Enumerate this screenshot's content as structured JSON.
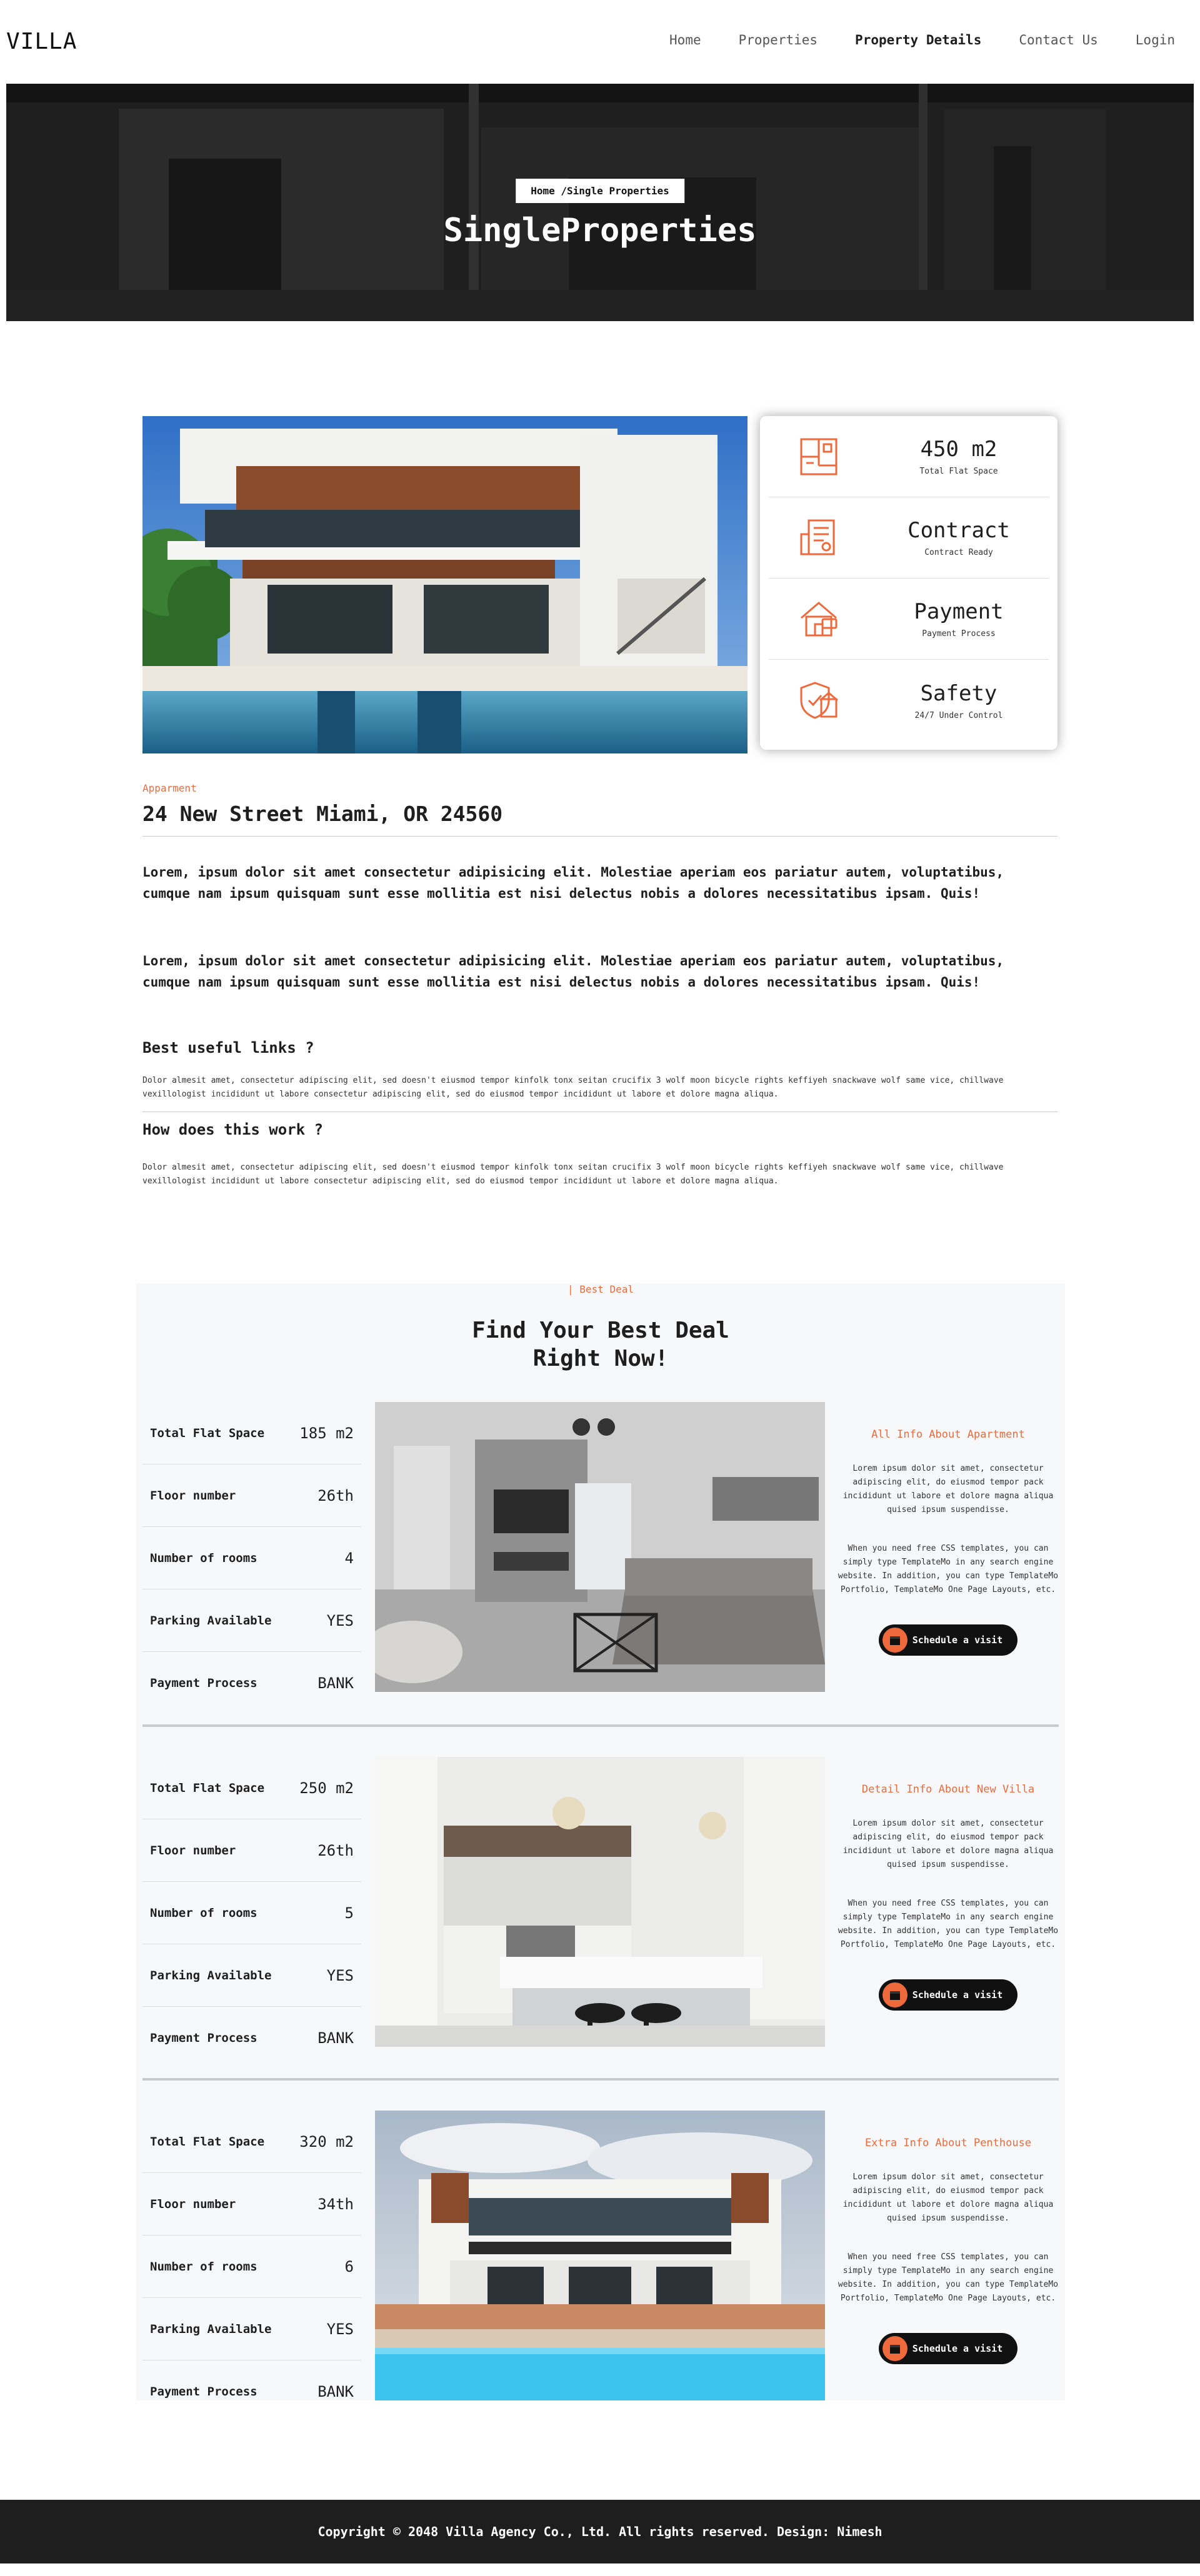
{
  "nav": {
    "logo": "VILLA",
    "items": [
      "Home",
      "Properties",
      "Property Details",
      "Contact Us",
      "Login"
    ],
    "active_index": 2
  },
  "hero": {
    "breadcrumb": "Home /Single Properties",
    "title": "SingleProperties"
  },
  "property": {
    "info": [
      {
        "icon": "floor-plan-icon",
        "value": "450 m2",
        "caption": "Total Flat Space"
      },
      {
        "icon": "contract-icon",
        "value": "Contract",
        "caption": "Contract Ready"
      },
      {
        "icon": "payment-house-icon",
        "value": "Payment",
        "caption": "Payment Process"
      },
      {
        "icon": "safety-shield-icon",
        "value": "Safety",
        "caption": "24/7 Under Control"
      }
    ],
    "category": "Apparment",
    "address": "24 New Street Miami, OR 24560",
    "paragraphs": [
      "Lorem, ipsum dolor sit amet consectetur adipisicing elit. Molestiae aperiam eos pariatur autem, voluptatibus, cumque nam ipsum quisquam sunt esse mollitia est nisi delectus nobis a dolores necessitatibus ipsam. Quis!",
      "Lorem, ipsum dolor sit amet consectetur adipisicing elit. Molestiae aperiam eos pariatur autem, voluptatibus, cumque nam ipsum quisquam sunt esse mollitia est nisi delectus nobis a dolores necessitatibus ipsam. Quis!"
    ],
    "faq": [
      {
        "question": "Best useful links ?",
        "answer": "Dolor almesit amet, consectetur adipiscing elit, sed doesn't eiusmod tempor kinfolk tonx seitan crucifix 3 wolf moon bicycle rights keffiyeh snackwave wolf same vice, chillwave vexillologist incididunt ut labore consectetur adipiscing elit, sed do eiusmod tempor incididunt ut labore et dolore magna aliqua."
      },
      {
        "question": "How does this work ?",
        "answer": "Dolor almesit amet, consectetur adipiscing elit, sed doesn't eiusmod tempor kinfolk tonx seitan crucifix 3 wolf moon bicycle rights keffiyeh snackwave wolf same vice, chillwave vexillologist incididunt ut labore consectetur adipiscing elit, sed do eiusmod tempor incididunt ut labore et dolore magna aliqua."
      }
    ]
  },
  "deal": {
    "tag": "| Best Deal",
    "title_line1": "Find Your Best Deal",
    "title_line2": "Right Now!",
    "spec_labels": [
      "Total Flat Space",
      "Floor number",
      "Number of rooms",
      "Parking Available",
      "Payment Process"
    ],
    "blocks": [
      {
        "specs": [
          "185 m2",
          "26th",
          "4",
          "YES",
          "BANK"
        ],
        "title": "All Info About Apartment",
        "p1": "Lorem ipsum dolor sit amet, consectetur adipiscing elit, do eiusmod tempor pack incididunt ut labore et dolore magna aliqua quised ipsum suspendisse.",
        "p2": "When you need free CSS templates, you can simply type TemplateMo in any search engine website. In addition, you can type TemplateMo Portfolio, TemplateMo One Page Layouts, etc.",
        "button": "Schedule a visit"
      },
      {
        "specs": [
          "250 m2",
          "26th",
          "5",
          "YES",
          "BANK"
        ],
        "title": "Detail Info About New Villa",
        "p1": "Lorem ipsum dolor sit amet, consectetur adipiscing elit, do eiusmod tempor pack incididunt ut labore et dolore magna aliqua quised ipsum suspendisse.",
        "p2": "When you need free CSS templates, you can simply type TemplateMo in any search engine website. In addition, you can type TemplateMo Portfolio, TemplateMo One Page Layouts, etc.",
        "button": "Schedule a visit"
      },
      {
        "specs": [
          "320 m2",
          "34th",
          "6",
          "YES",
          "BANK"
        ],
        "title": "Extra Info About Penthouse",
        "p1": "Lorem ipsum dolor sit amet, consectetur adipiscing elit, do eiusmod tempor pack incididunt ut labore et dolore magna aliqua quised ipsum suspendisse.",
        "p2": "When you need free CSS templates, you can simply type TemplateMo in any search engine website. In addition, you can type TemplateMo Portfolio, TemplateMo One Page Layouts, etc.",
        "button": "Schedule a visit"
      }
    ]
  },
  "footer": {
    "text": "Copyright © 2048 Villa Agency Co., Ltd. All rights reserved. Design: Nimesh"
  },
  "colors": {
    "accent": "#ee6a3c",
    "dark": "#1e1e1e",
    "deal_bg": "#f7f8fa"
  }
}
